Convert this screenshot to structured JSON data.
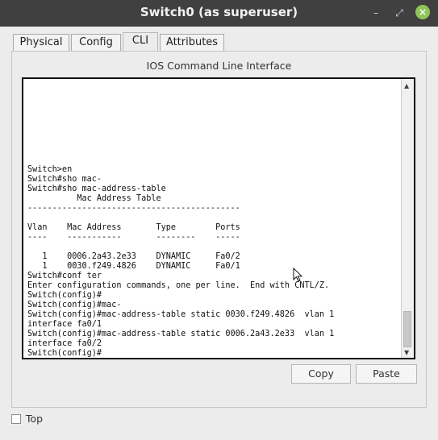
{
  "window": {
    "title": "Switch0 (as superuser)",
    "min_glyph": "–",
    "max_glyph": "⤢",
    "close_glyph": "×"
  },
  "tabs": [
    {
      "label": "Physical"
    },
    {
      "label": "Config"
    },
    {
      "label": "CLI"
    },
    {
      "label": "Attributes"
    }
  ],
  "active_tab": "CLI",
  "panel": {
    "title": "IOS Command Line Interface"
  },
  "terminal": {
    "lines": [
      "Switch>en",
      "Switch#sho mac-",
      "Switch#sho mac-address-table",
      "          Mac Address Table",
      "-------------------------------------------",
      "",
      "Vlan    Mac Address       Type        Ports",
      "----    -----------       --------    -----",
      "",
      "   1    0006.2a43.2e33    DYNAMIC     Fa0/2",
      "   1    0030.f249.4826    DYNAMIC     Fa0/1",
      "Switch#conf ter",
      "Enter configuration commands, one per line.  End with CNTL/Z.",
      "Switch(config)#",
      "Switch(config)#mac-",
      "Switch(config)#mac-address-table static 0030.f249.4826  vlan 1",
      "interface fa0/1",
      "Switch(config)#mac-address-table static 0006.2a43.2e33  vlan 1",
      "interface fa0/2",
      "Switch(config)#"
    ]
  },
  "buttons": {
    "copy": "Copy",
    "paste": "Paste"
  },
  "footer": {
    "top_label": "Top"
  }
}
